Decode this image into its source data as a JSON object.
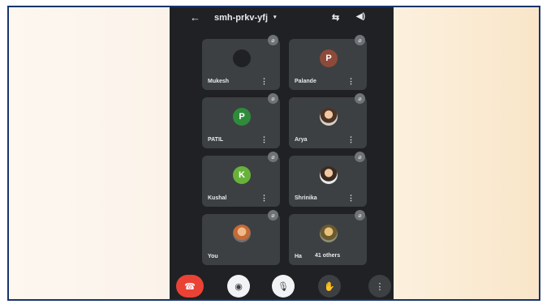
{
  "meeting": {
    "code": "smh-prkv-yfj"
  },
  "icons": {
    "back": "←",
    "caret": "▾",
    "camera_switch": "⇆",
    "speaker": "◀)",
    "mic_off": "⌀",
    "more": "⋮",
    "end_call": "☎",
    "video": "◉",
    "mic": "🎙",
    "hand": "✋",
    "menu": "⋮"
  },
  "colors": {
    "app_bg": "#202124",
    "tile_bg": "#3c4043",
    "end_call": "#ea4335",
    "frame_border": "#16356a"
  },
  "tiles": [
    {
      "name": "Mukesh",
      "initial": "",
      "avatar_color": "#202124"
    },
    {
      "name": "Palande",
      "initial": "P",
      "avatar_color": "#8d4a3a"
    },
    {
      "name": "PATIL",
      "initial": "P",
      "avatar_color": "#2e8b3a"
    },
    {
      "name": "Arya",
      "initial": "",
      "avatar_color": ""
    },
    {
      "name": "Kushal",
      "initial": "K",
      "avatar_color": "#67b23b"
    },
    {
      "name": "Shrinika",
      "initial": "",
      "avatar_color": ""
    },
    {
      "name": "You",
      "initial": "",
      "avatar_color": ""
    },
    {
      "name": "Ha",
      "initial": "",
      "avatar_color": "",
      "others": "41 others"
    }
  ]
}
